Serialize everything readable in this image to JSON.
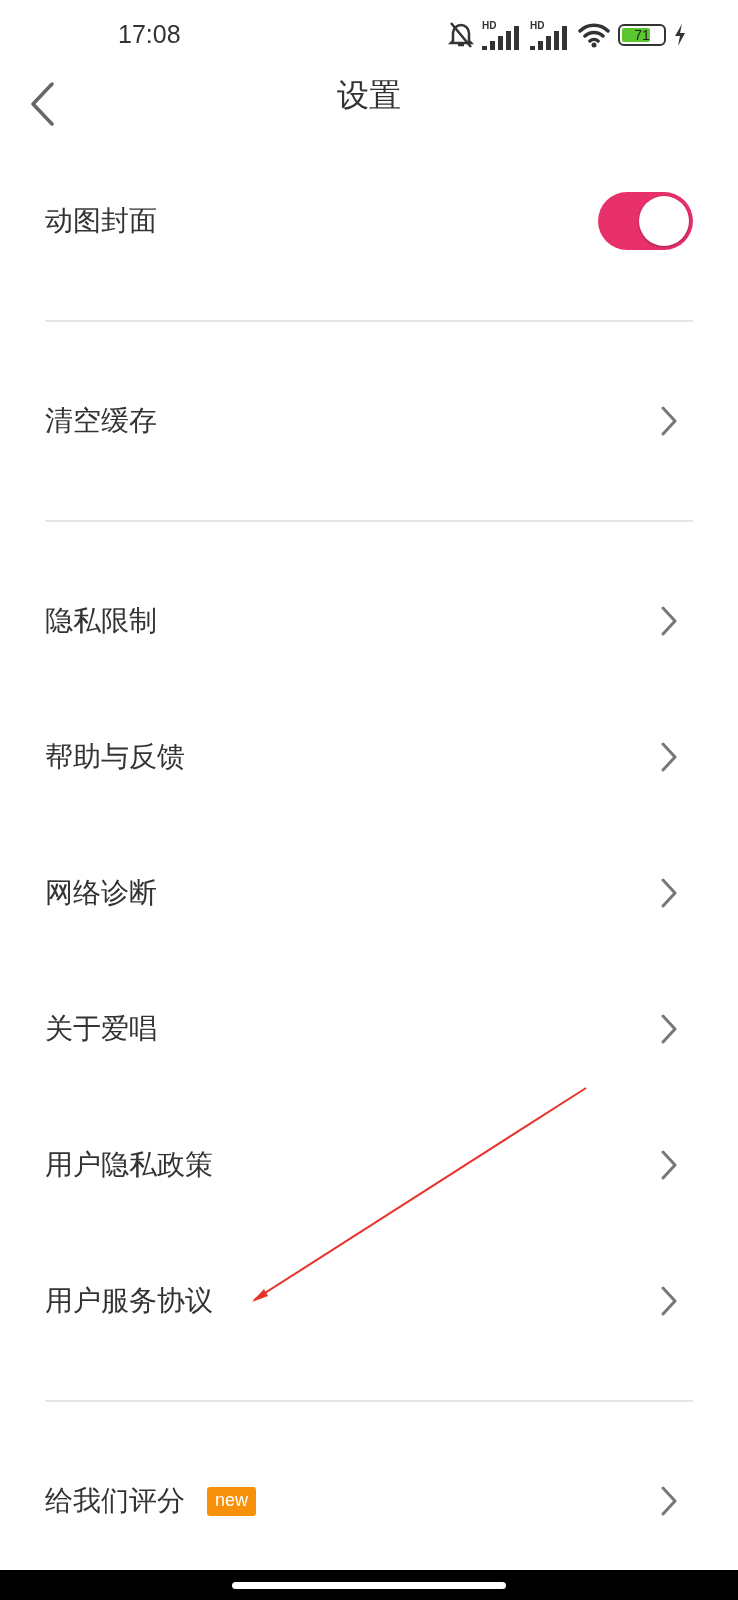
{
  "status_bar": {
    "time": "17:08",
    "signals": [
      {
        "label": "HD"
      },
      {
        "label": "HD"
      }
    ],
    "battery": {
      "label": "71",
      "charging": true
    }
  },
  "header": {
    "title": "设置"
  },
  "sections": [
    {
      "items": [
        {
          "kind": "toggle",
          "label": "动图封面",
          "on": true
        }
      ]
    },
    {
      "items": [
        {
          "kind": "link",
          "label": "清空缓存"
        }
      ]
    },
    {
      "items": [
        {
          "kind": "link",
          "label": "隐私限制"
        },
        {
          "kind": "link",
          "label": "帮助与反馈"
        },
        {
          "kind": "link",
          "label": "网络诊断"
        },
        {
          "kind": "link",
          "label": "关于爱唱"
        },
        {
          "kind": "link",
          "label": "用户隐私政策"
        },
        {
          "kind": "link",
          "label": "用户服务协议"
        }
      ]
    },
    {
      "items": [
        {
          "kind": "link",
          "label": "给我们评分",
          "badge": "new"
        }
      ]
    }
  ]
}
